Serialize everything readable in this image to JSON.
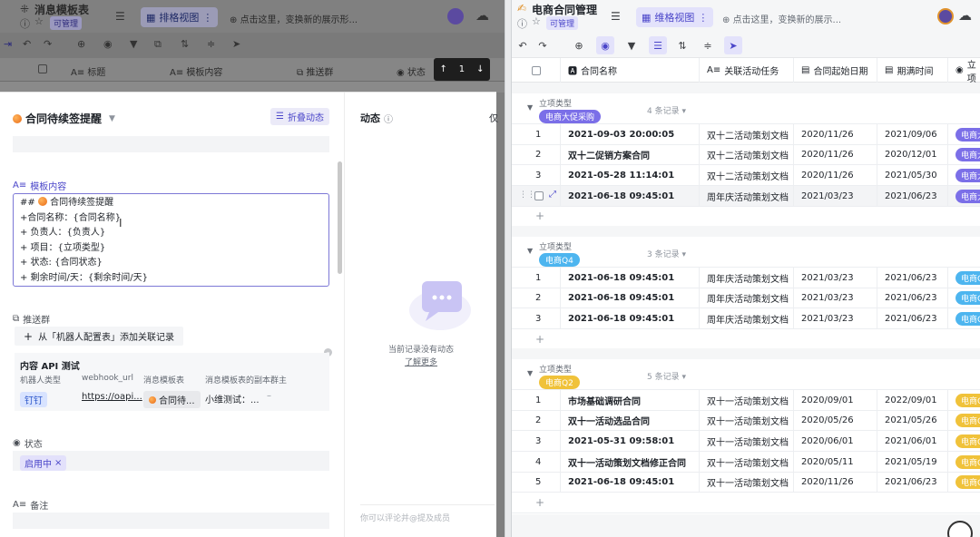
{
  "left": {
    "title": "消息模板表",
    "perm_badge": "可管理",
    "view_tab": "排格视图",
    "view_hint": "点击这里，变换新的展示形...",
    "columns": [
      "标题",
      "模板内容",
      "推送群",
      "状态"
    ],
    "nav_counter": "1",
    "modal": {
      "record_title": "合同待续签提醒",
      "fold_btn": "折叠动态",
      "activity_title": "动态",
      "activity_extra": "仅",
      "template_label": "模板内容",
      "template_lines": [
        "## 🟠 合同待续签提醒",
        "+合同名称：{合同名称}",
        "+ 负责人：{负责人}",
        "+ 项目：{立项类型}",
        "+ 状态: {合同状态}",
        "+ 剩余时间/天：{剩余时间/天}"
      ],
      "push_group_label": "推送群",
      "add_link_label": "从「机器人配置表」添加关联记录",
      "api_title": "内容 API 测试",
      "api_headers": [
        "机器人类型",
        "webhook_url",
        "消息模板表",
        "消息模板表的副本群主"
      ],
      "api_values": [
        "钉钉",
        "https://oapi...",
        "合同待...",
        "小维测试：..."
      ],
      "api_dash": "–",
      "status_label": "状态",
      "status_value": "启用中",
      "remark_label": "备注",
      "empty_text": "当前记录没有动态",
      "learn_more": "了解更多",
      "comment_placeholder": "你可以评论并@提及成员"
    }
  },
  "right": {
    "title": "电商合同管理",
    "perm_badge": "可管理",
    "view_tab": "维格视图",
    "view_hint": "点击这里，变换新的展示...",
    "columns": [
      "合同名称",
      "关联活动任务",
      "合同起始日期",
      "期满时间",
      "立项"
    ],
    "group_field": "立项类型",
    "groups": [
      {
        "tag": "电商大促采购",
        "color": "#7b6fe8",
        "count": "4 条记录",
        "rows": [
          {
            "no": "1",
            "name": "2021-09-03 20:00:05",
            "task": "双十二活动策划文档",
            "start": "2020/11/26",
            "end": "2021/09/06",
            "tag": "电商大"
          },
          {
            "no": "2",
            "name": "双十二促销方案合同",
            "task": "双十二活动策划文档",
            "start": "2020/11/26",
            "end": "2020/12/01",
            "tag": "电商大"
          },
          {
            "no": "3",
            "name": "2021-05-28 11:14:01",
            "task": "双十二活动策划文档",
            "start": "2020/11/26",
            "end": "2021/05/30",
            "tag": "电商大"
          },
          {
            "no": "4",
            "name": "2021-06-18 09:45:01",
            "task": "周年庆活动策划文档",
            "start": "2021/03/23",
            "end": "2021/06/23",
            "tag": "电商大"
          }
        ]
      },
      {
        "tag": "电商Q4",
        "color": "#4db5ef",
        "count": "3 条记录",
        "rows": [
          {
            "no": "1",
            "name": "2021-06-18 09:45:01",
            "task": "周年庆活动策划文档",
            "start": "2021/03/23",
            "end": "2021/06/23",
            "tag": "电商Q"
          },
          {
            "no": "2",
            "name": "2021-06-18 09:45:01",
            "task": "周年庆活动策划文档",
            "start": "2021/03/23",
            "end": "2021/06/23",
            "tag": "电商Q"
          },
          {
            "no": "3",
            "name": "2021-06-18 09:45:01",
            "task": "周年庆活动策划文档",
            "start": "2021/03/23",
            "end": "2021/06/23",
            "tag": "电商Q"
          }
        ]
      },
      {
        "tag": "电商Q2",
        "color": "#f0c23a",
        "count": "5 条记录",
        "rows": [
          {
            "no": "1",
            "name": "市场基础调研合同",
            "task": "双十一活动策划文档",
            "start": "2020/09/01",
            "end": "2022/09/01",
            "tag": "电商Q"
          },
          {
            "no": "2",
            "name": "双十一活动选品合同",
            "task": "双十一活动策划文档",
            "start": "2020/05/26",
            "end": "2021/05/26",
            "tag": "电商Q"
          },
          {
            "no": "3",
            "name": "2021-05-31 09:58:01",
            "task": "双十一活动策划文档",
            "start": "2020/06/01",
            "end": "2021/06/01",
            "tag": "电商Q"
          },
          {
            "no": "4",
            "name": "双十一活动策划文档修正合同",
            "task": "双十一活动策划文档",
            "start": "2020/05/11",
            "end": "2021/05/19",
            "tag": "电商Q"
          },
          {
            "no": "5",
            "name": "2021-06-18 09:45:01",
            "task": "双十一活动策划文档",
            "start": "2020/11/26",
            "end": "2021/06/23",
            "tag": "电商Q"
          }
        ]
      }
    ],
    "add_row": "+"
  }
}
